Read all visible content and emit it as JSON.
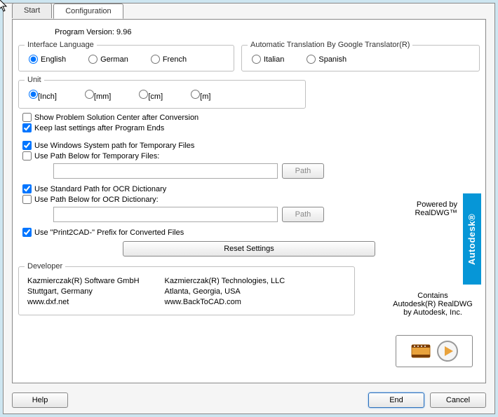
{
  "tabs": {
    "start": "Start",
    "config": "Configuration"
  },
  "version": "Program Version: 9.96",
  "lang": {
    "legend": "Interface Language",
    "english": "English",
    "german": "German",
    "french": "French"
  },
  "auto": {
    "legend": "Automatic Translation By Google Translator(R)",
    "italian": "Italian",
    "spanish": "Spanish"
  },
  "unit": {
    "legend": "Unit",
    "inch": "[Inch]",
    "mm": "[mm]",
    "cm": "[cm]",
    "m": "[m]"
  },
  "chk": {
    "psc": "Show Problem Solution Center after Conversion",
    "keep": "Keep last settings after Program Ends",
    "wintmp": "Use Windows System path for Temporary Files",
    "belowtmp": "Use Path Below for Temporary Files:",
    "stdocr": "Use Standard Path for OCR Dictionary",
    "belowocr": "Use Path Below for OCR Dictionary:",
    "prefix": "Use \"Print2CAD-\" Prefix for Converted Files"
  },
  "pathbtn": "Path",
  "reset": "Reset Settings",
  "dev": {
    "legend": "Developer",
    "l1": "Kazmierczak(R) Software GmbH",
    "l2": "Stuttgart, Germany",
    "l3": "www.dxf.net",
    "r1": "Kazmierczak(R) Technologies, LLC",
    "r2": "Atlanta, Georgia, USA",
    "r3": "www.BackToCAD.com"
  },
  "powered": {
    "l1": "Powered by",
    "l2": "RealDWG™"
  },
  "autodesk": "Autodesk®",
  "contains": {
    "l1": "Contains",
    "l2": "Autodesk(R) RealDWG",
    "l3": "by Autodesk, Inc."
  },
  "buttons": {
    "help": "Help",
    "end": "End",
    "cancel": "Cancel"
  }
}
